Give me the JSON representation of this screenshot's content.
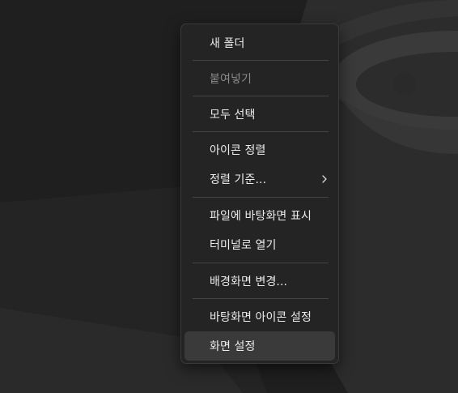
{
  "colors": {
    "menu_background": "#242424",
    "menu_text": "#ececec",
    "disabled_text": "#8a8a8a",
    "hover_background": "#3a3a3a",
    "separator": "#444444",
    "wallpaper_dark": "#1f1f1f",
    "wallpaper_light": "#2f2f2f"
  },
  "context_menu": {
    "items": [
      {
        "label": "새 폴더",
        "disabled": false
      },
      {
        "label": "붙여넣기",
        "disabled": true
      },
      {
        "label": "모두 선택",
        "disabled": false
      },
      {
        "label": "아이콘 정렬",
        "disabled": false
      },
      {
        "label": "정렬 기준...",
        "disabled": false,
        "submenu_icon": "chevron-right-icon"
      },
      {
        "label": "파일에 바탕화면 표시",
        "disabled": false
      },
      {
        "label": "터미널로 열기",
        "disabled": false
      },
      {
        "label": "배경화면 변경...",
        "disabled": false
      },
      {
        "label": "바탕화면 아이콘 설정",
        "disabled": false
      },
      {
        "label": "화면 설정",
        "disabled": false,
        "hovered": true
      }
    ]
  }
}
